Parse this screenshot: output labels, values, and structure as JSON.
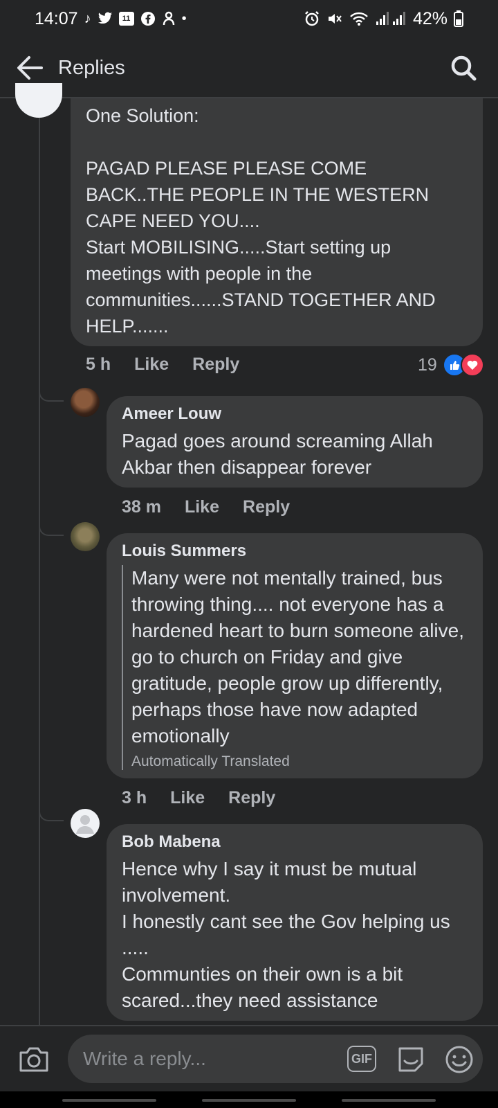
{
  "status_bar": {
    "time": "14:07",
    "battery": "42%",
    "left_icons": [
      "tiktok-icon",
      "twitter-icon",
      "calendar-icon",
      "facebook-icon",
      "messenger-icon"
    ],
    "calendar_day": "11",
    "dot": "•"
  },
  "header": {
    "title": "Replies"
  },
  "comment": {
    "text": "One Solution:\n\nPAGAD PLEASE PLEASE COME BACK..THE PEOPLE IN THE WESTERN CAPE NEED YOU....\nStart MOBILISING.....Start setting up meetings with people in the communities......STAND TOGETHER AND HELP.......",
    "time": "5 h",
    "like_label": "Like",
    "reply_label": "Reply",
    "reaction_count": "19"
  },
  "replies": [
    {
      "author": "Ameer Louw",
      "text": "Pagad goes around screaming Allah Akbar  then disappear forever",
      "time": "38 m",
      "like_label": "Like",
      "reply_label": "Reply"
    },
    {
      "author": "Louis Summers",
      "text": "Many were not mentally trained, bus throwing thing.... not everyone has a hardened heart to burn someone alive, go to church on Friday and give gratitude, people grow up differently, perhaps those have now adapted emotionally",
      "translated_label": "Automatically Translated",
      "time": "3 h",
      "like_label": "Like",
      "reply_label": "Reply"
    },
    {
      "author": "Bob Mabena",
      "text": "Hence why I say it must be mutual involvement.\nI honestly cant see the Gov helping us .....\nCommunties on their own is a bit scared...they need assistance"
    }
  ],
  "composer": {
    "placeholder": "Write a reply...",
    "gif_label": "GIF"
  },
  "colors": {
    "background": "#242526",
    "bubble": "#3a3b3c",
    "text": "#e4e6eb",
    "muted": "#b0b3b8",
    "like_blue": "#1877f2",
    "love_red": "#f33e58"
  }
}
